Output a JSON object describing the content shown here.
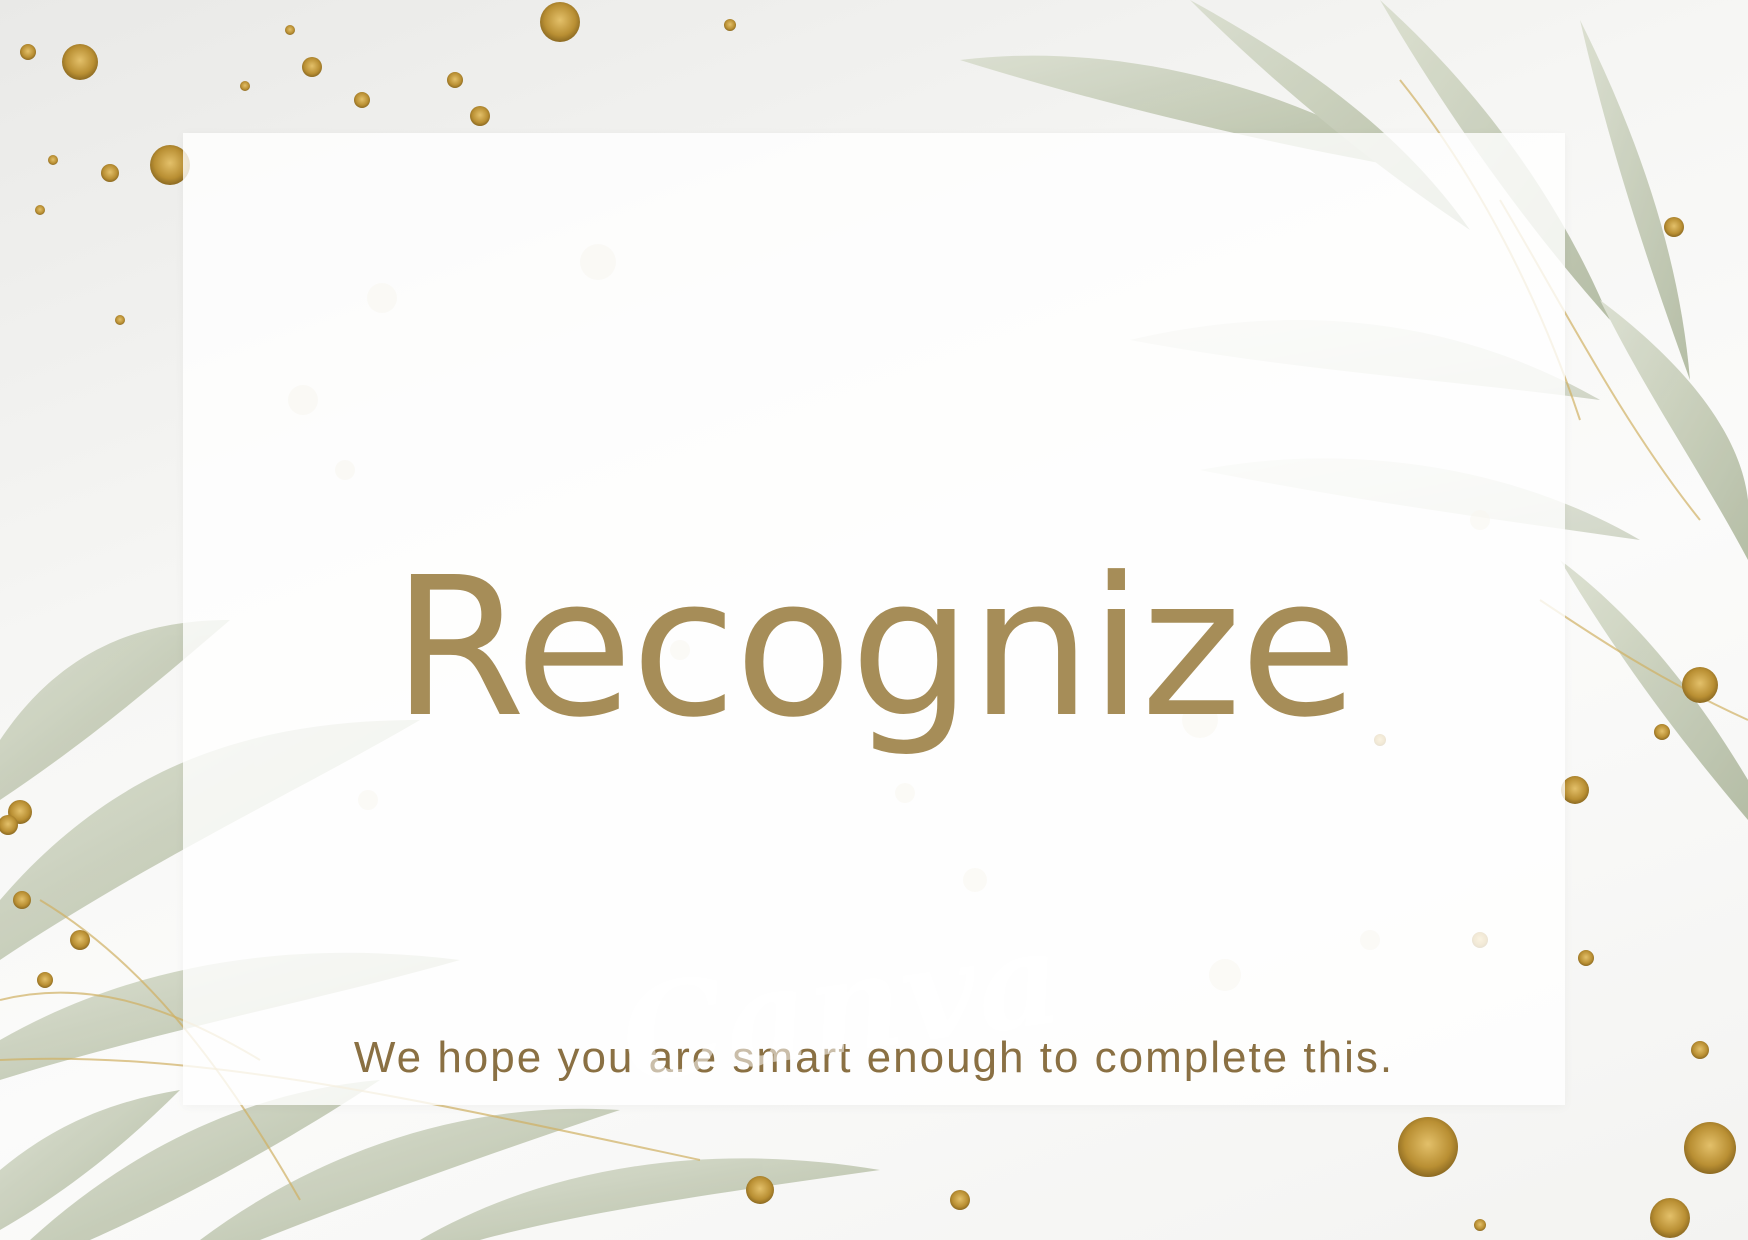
{
  "title": "Recognize",
  "subtitle": "We hope you are smart enough to complete this.",
  "watermark": "Canva",
  "colors": {
    "title": "#a68d58",
    "subtitle": "#8a7043",
    "gold": "#c9a449",
    "leaf": "#b9c1a8"
  },
  "decorations": [
    "gold-glitter-dots",
    "watercolor-leaves"
  ]
}
